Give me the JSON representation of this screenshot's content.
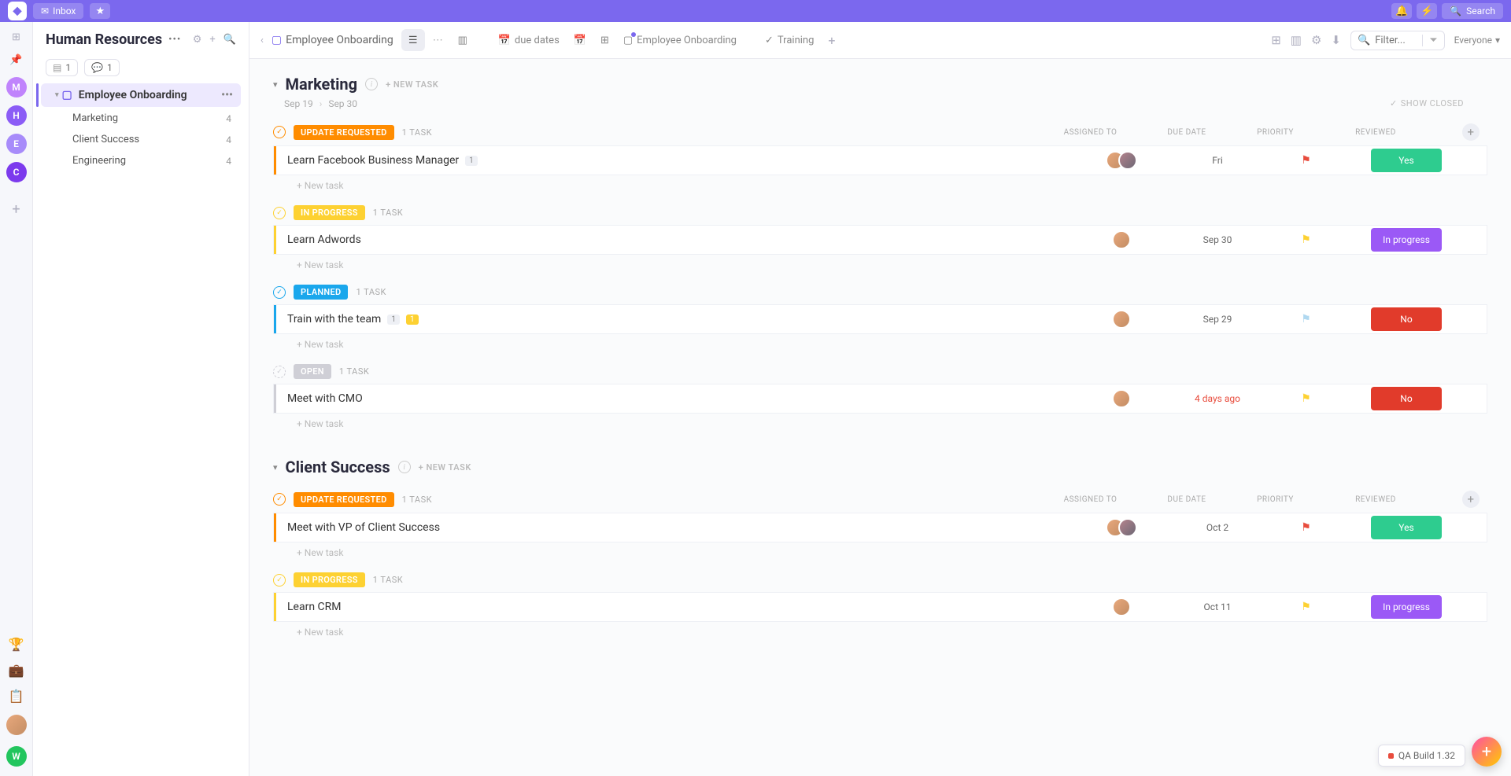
{
  "topbar": {
    "inbox_label": "Inbox",
    "search_label": "Search"
  },
  "sidebar": {
    "title": "Human Resources",
    "pill_docs": "1",
    "pill_chat": "1",
    "active_item": "Employee Onboarding",
    "sublists": [
      {
        "label": "Marketing",
        "count": "4"
      },
      {
        "label": "Client Success",
        "count": "4"
      },
      {
        "label": "Engineering",
        "count": "4"
      }
    ]
  },
  "rail": {
    "avatars": [
      {
        "letter": "M",
        "color": "#c084fc"
      },
      {
        "letter": "H",
        "color": "#8b5cf6"
      },
      {
        "letter": "E",
        "color": "#a78bfa"
      },
      {
        "letter": "C",
        "color": "#7c3aed"
      }
    ],
    "bottom_letter": "W",
    "bottom_color": "#22c55e"
  },
  "crumb": {
    "label": "Employee Onboarding",
    "tabs": [
      {
        "icon": "calendar-icon",
        "label": "due dates"
      },
      {
        "icon": "calendar-icon",
        "label": ""
      },
      {
        "icon": "grid-icon",
        "label": ""
      },
      {
        "icon": "folder-icon",
        "label": "Employee Onboarding",
        "dot": true
      },
      {
        "icon": "code-icon",
        "label": ""
      },
      {
        "icon": "check-icon",
        "label": "Training"
      }
    ],
    "filter_placeholder": "Filter...",
    "everyone_label": "Everyone"
  },
  "common": {
    "new_task_upper": "+ NEW TASK",
    "new_task_lower": "+ New task",
    "show_closed": "SHOW CLOSED",
    "cols": {
      "assigned": "ASSIGNED TO",
      "due": "DUE DATE",
      "priority": "PRIORITY",
      "reviewed": "REVIEWED"
    }
  },
  "groups": [
    {
      "name": "Marketing",
      "start": "Sep 19",
      "end": "Sep 30",
      "show_cols": true,
      "sections": [
        {
          "status": "UPDATE REQUESTED",
          "color": "#ff8c00",
          "count": "1 TASK",
          "circle_solid": true,
          "circle_color": "#ff8c00",
          "tasks": [
            {
              "name": "Learn Facebook Business Manager",
              "badges": [
                {
                  "text": "1",
                  "cls": ""
                }
              ],
              "avatars": 2,
              "due": "Fri",
              "overdue": false,
              "flag": "#e84c3d",
              "review_text": "Yes",
              "review_color": "#2ecc8f"
            }
          ]
        },
        {
          "status": "IN PROGRESS",
          "color": "#fdd132",
          "count": "1 TASK",
          "circle_solid": true,
          "circle_color": "#fdd132",
          "tasks": [
            {
              "name": "Learn Adwords",
              "badges": [],
              "avatars": 1,
              "due": "Sep 30",
              "overdue": false,
              "flag": "#fdd132",
              "review_text": "In progress",
              "review_color": "#9b59f6"
            }
          ]
        },
        {
          "status": "PLANNED",
          "color": "#1aa7ec",
          "count": "1 TASK",
          "circle_solid": true,
          "circle_color": "#1aa7ec",
          "tasks": [
            {
              "name": "Train with the team",
              "badges": [
                {
                  "text": "1",
                  "cls": ""
                },
                {
                  "text": "1",
                  "cls": "yellow"
                }
              ],
              "avatars": 1,
              "due": "Sep 29",
              "overdue": false,
              "flag": "#b0d8f0",
              "review_text": "No",
              "review_color": "#e13b2b"
            }
          ]
        },
        {
          "status": "OPEN",
          "color": "#cfcfd6",
          "count": "1 TASK",
          "circle_solid": false,
          "circle_color": "#cfcfd6",
          "tasks": [
            {
              "name": "Meet with CMO",
              "badges": [],
              "avatars": 1,
              "due": "4 days ago",
              "overdue": true,
              "flag": "#fdd132",
              "review_text": "No",
              "review_color": "#e13b2b"
            }
          ]
        }
      ]
    },
    {
      "name": "Client Success",
      "show_cols": true,
      "sections": [
        {
          "status": "UPDATE REQUESTED",
          "color": "#ff8c00",
          "count": "1 TASK",
          "circle_solid": true,
          "circle_color": "#ff8c00",
          "tasks": [
            {
              "name": "Meet with VP of Client Success",
              "badges": [],
              "avatars": 2,
              "due": "Oct 2",
              "overdue": false,
              "flag": "#e84c3d",
              "review_text": "Yes",
              "review_color": "#2ecc8f"
            }
          ]
        },
        {
          "status": "IN PROGRESS",
          "color": "#fdd132",
          "count": "1 TASK",
          "circle_solid": true,
          "circle_color": "#fdd132",
          "tasks": [
            {
              "name": "Learn CRM",
              "badges": [],
              "avatars": 1,
              "due": "Oct 11",
              "overdue": false,
              "flag": "#fdd132",
              "review_text": "In progress",
              "review_color": "#9b59f6"
            }
          ]
        }
      ]
    }
  ],
  "floating": {
    "qa_label": "QA Build 1.32"
  }
}
